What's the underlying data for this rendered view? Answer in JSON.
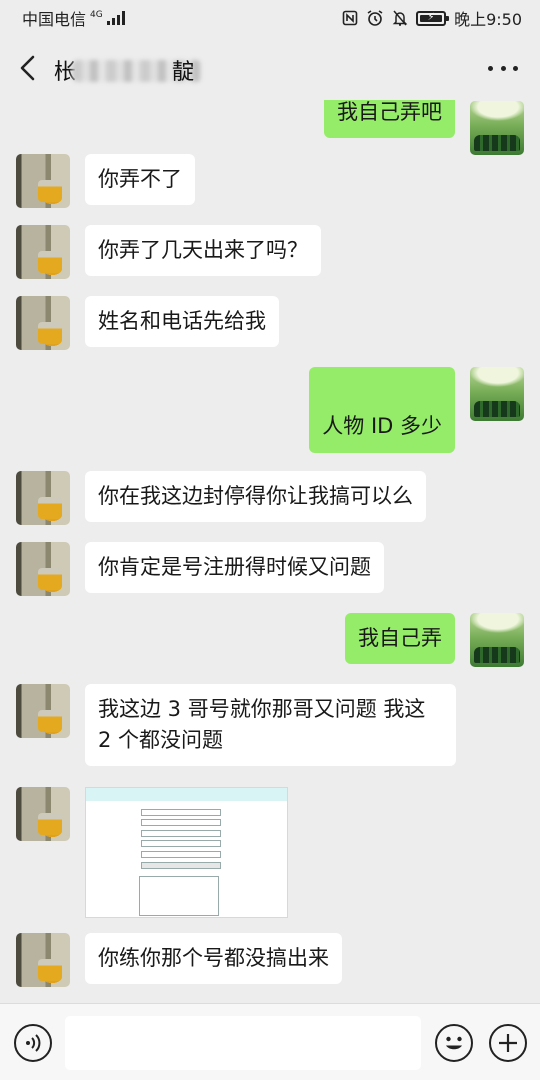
{
  "status_bar": {
    "carrier": "中国电信",
    "network": "4G",
    "time": "晚上9:50",
    "icons": [
      "nfc-icon",
      "alarm-icon",
      "mute-icon",
      "battery-charging-icon",
      "signal-icon"
    ]
  },
  "header": {
    "title_visible": "枨",
    "title_trailing": "靛",
    "back_icon": "back-chevron-icon",
    "more_icon": "more-dots-icon"
  },
  "messages": [
    {
      "side": "me",
      "text": "我自己弄吧"
    },
    {
      "side": "them",
      "text": "你弄不了"
    },
    {
      "side": "them",
      "text": "你弄了几天出来了吗？"
    },
    {
      "side": "them",
      "text": "姓名和电话先给我"
    },
    {
      "side": "me",
      "text": "人物 ID 多少"
    },
    {
      "side": "them",
      "text": "你在我这边封停得你让我搞可以么"
    },
    {
      "side": "them",
      "text": "你肯定是号注册得时候又问题"
    },
    {
      "side": "me",
      "text": "我自己弄"
    },
    {
      "side": "them",
      "text": "我这边 3 哥号就你那哥又问题 我这 2 个都没问题"
    },
    {
      "side": "them",
      "type": "image",
      "text": ""
    },
    {
      "side": "them",
      "text": "你练你那个号都没搞出来"
    }
  ],
  "input_bar": {
    "voice_icon": "voice-icon",
    "emoji_icon": "emoji-icon",
    "plus_icon": "plus-icon",
    "placeholder": ""
  }
}
